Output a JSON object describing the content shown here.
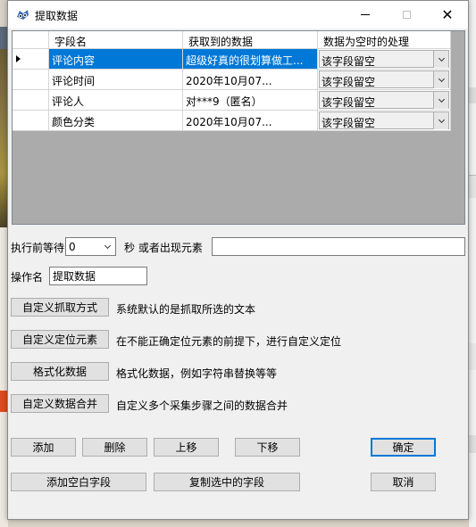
{
  "window": {
    "title": "提取数据",
    "minimize_icon": "minimize-icon",
    "maximize_icon": "maximize-icon",
    "close_label": "✕"
  },
  "grid": {
    "columns": [
      "字段名",
      "获取到的数据",
      "数据为空时的处理"
    ],
    "rows": [
      {
        "field": "评论内容",
        "data": "超级好真的很划算做工...",
        "empty_handling": "该字段留空",
        "selected": true
      },
      {
        "field": "评论时间",
        "data": "2020年10月07...",
        "empty_handling": "该字段留空",
        "selected": false
      },
      {
        "field": "评论人",
        "data": "对***9（匿名）",
        "empty_handling": "该字段留空",
        "selected": false
      },
      {
        "field": "颜色分类",
        "data": "2020年10月07...",
        "empty_handling": "该字段留空",
        "selected": false
      }
    ]
  },
  "wait": {
    "label": "执行前等待",
    "value": "0",
    "unit_label": "秒 或者出现元素",
    "element_value": ""
  },
  "operation": {
    "label": "操作名",
    "value": "提取数据"
  },
  "actions": [
    {
      "button": "自定义抓取方式",
      "description": "系统默认的是抓取所选的文本"
    },
    {
      "button": "自定义定位元素",
      "description": "在不能正确定位元素的前提下，进行自定义定位"
    },
    {
      "button": "格式化数据",
      "description": "格式化数据，例如字符串替换等等"
    },
    {
      "button": "自定义数据合并",
      "description": "自定义多个采集步骤之间的数据合并"
    }
  ],
  "buttons": {
    "add": "添加",
    "delete": "删除",
    "move_up": "上移",
    "move_down": "下移",
    "ok": "确定",
    "add_blank": "添加空白字段",
    "copy_selected": "复制选中的字段",
    "cancel": "取消"
  },
  "colors": {
    "selection": "#0078d7",
    "dialog_bg": "#f0f0f0",
    "grid_bg": "#ababab"
  }
}
